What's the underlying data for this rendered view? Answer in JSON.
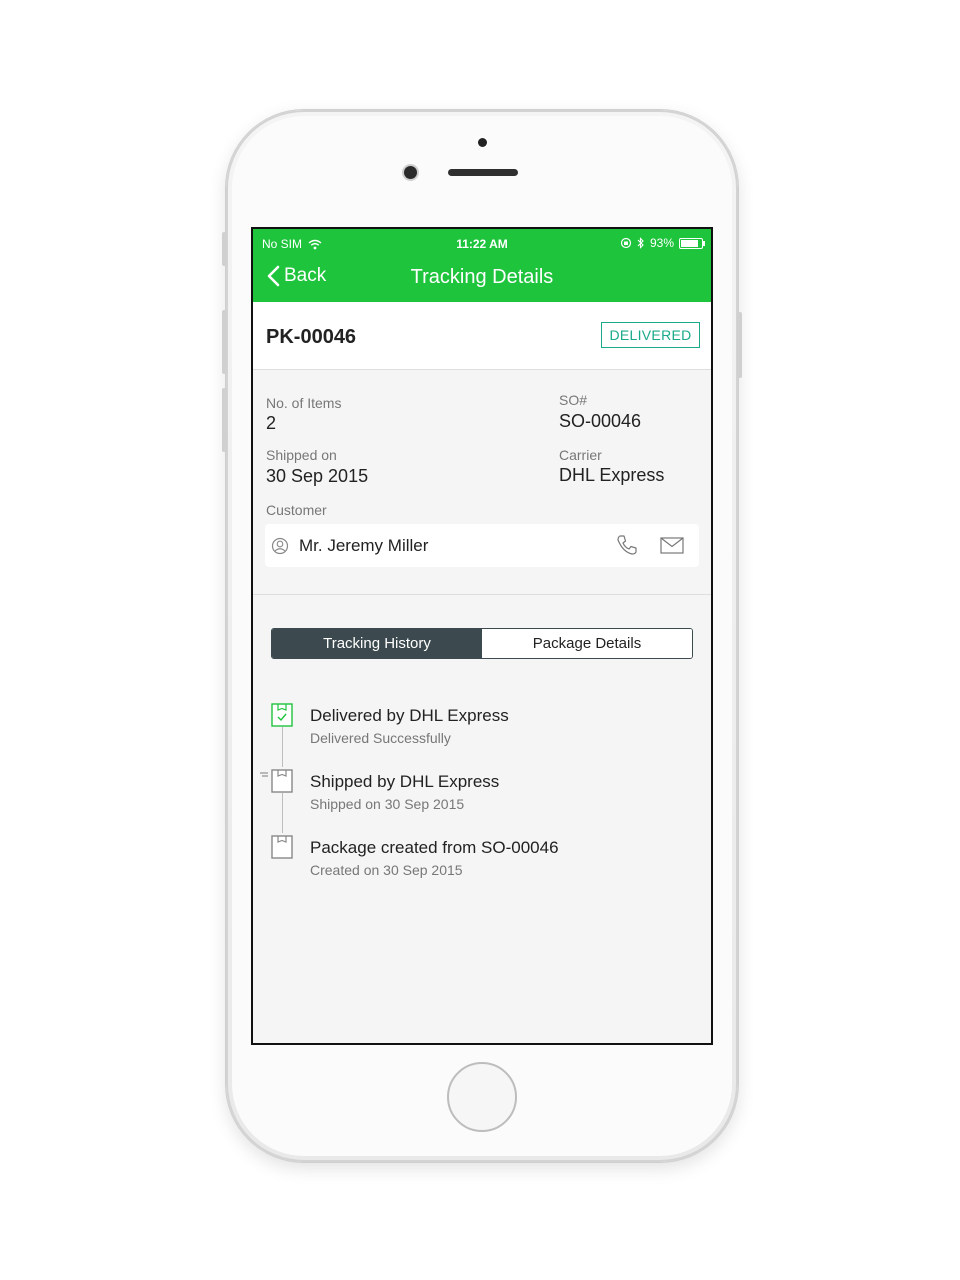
{
  "status_bar": {
    "carrier": "No SIM",
    "time": "11:22 AM",
    "battery": "93%",
    "battery_level": 0.93
  },
  "nav": {
    "back_label": "Back",
    "title": "Tracking Details"
  },
  "package": {
    "number": "PK-00046",
    "status": "DELIVERED"
  },
  "details": {
    "items_label": "No. of Items",
    "items_value": "2",
    "so_label": "SO#",
    "so_value": "SO-00046",
    "shipped_label": "Shipped on",
    "shipped_value": "30 Sep 2015",
    "carrier_label": "Carrier",
    "carrier_value": "DHL Express",
    "customer_label": "Customer",
    "customer_name": "Mr. Jeremy Miller"
  },
  "tabs": [
    {
      "label": "Tracking History",
      "active": true
    },
    {
      "label": "Package Details",
      "active": false
    }
  ],
  "history": [
    {
      "title": "Delivered by DHL Express",
      "subtitle": "Delivered Successfully",
      "icon": "box-delivered-icon"
    },
    {
      "title": "Shipped by DHL Express",
      "subtitle": "Shipped on 30 Sep 2015",
      "icon": "box-shipped-icon"
    },
    {
      "title": "Package created from SO-00046",
      "subtitle": "Created on 30 Sep 2015",
      "icon": "box-icon"
    }
  ],
  "colors": {
    "accent_green": "#1ec43c",
    "badge_teal": "#1aa98a",
    "tab_dark": "#3c4a4f"
  }
}
